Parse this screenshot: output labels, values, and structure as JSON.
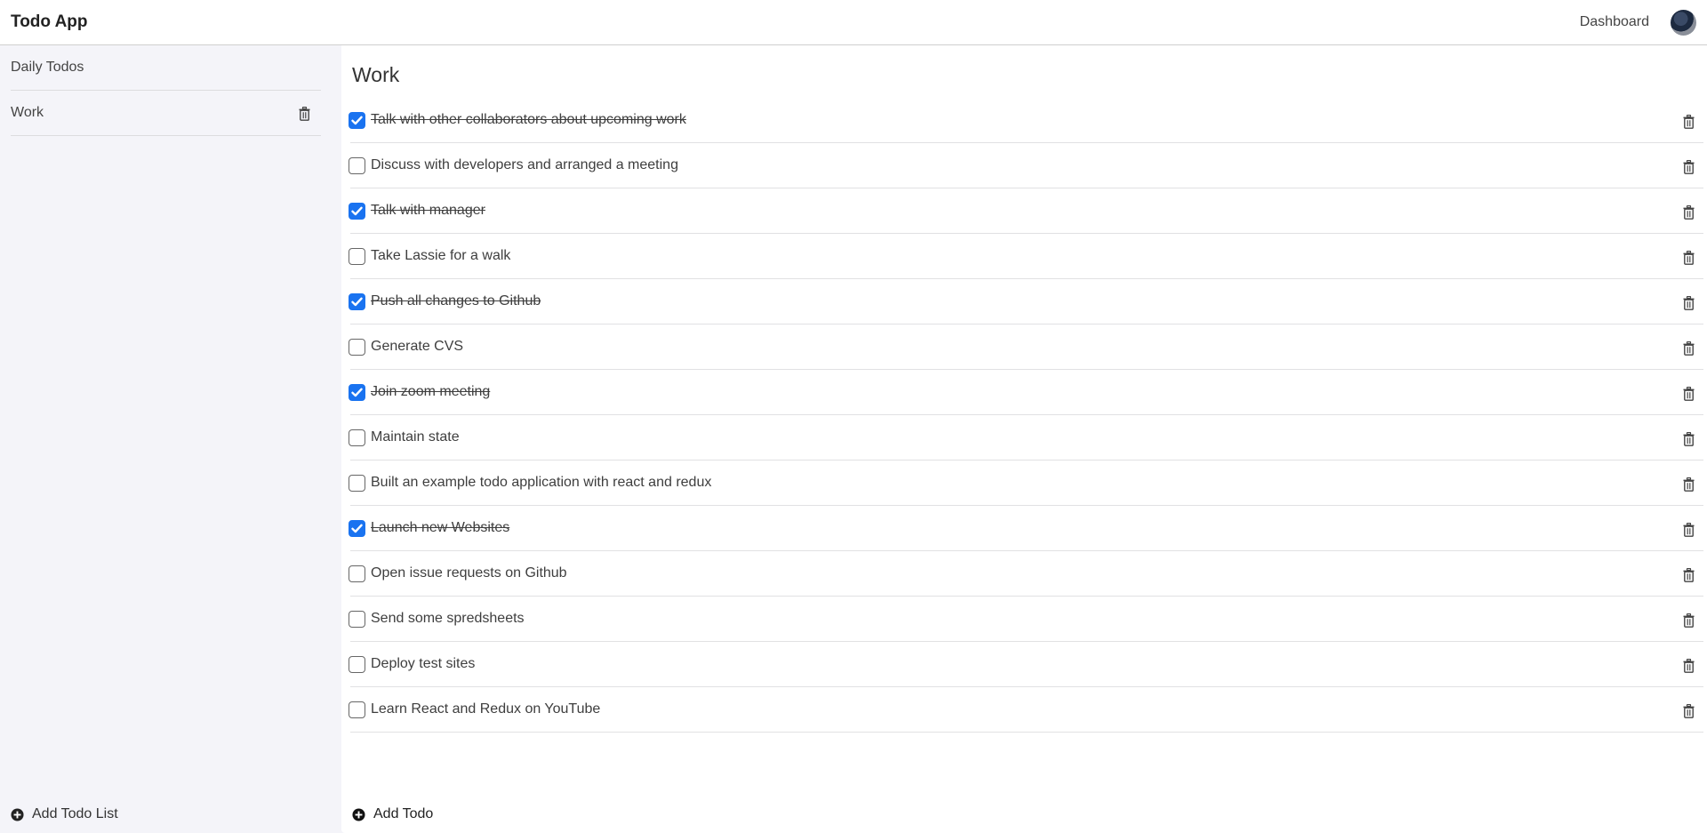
{
  "header": {
    "title": "Todo App",
    "dashboard_label": "Dashboard",
    "avatar_icon": "user-avatar"
  },
  "sidebar": {
    "items": [
      {
        "label": "Daily Todos",
        "has_delete": false
      },
      {
        "label": "Work",
        "has_delete": true
      }
    ],
    "add_list_label": "Add Todo List"
  },
  "main": {
    "title": "Work",
    "todos": [
      {
        "text": "Talk with other collaborators about upcoming work",
        "done": true
      },
      {
        "text": "Discuss with developers and arranged a meeting",
        "done": false
      },
      {
        "text": "Talk with manager",
        "done": true
      },
      {
        "text": "Take Lassie for a walk",
        "done": false
      },
      {
        "text": "Push all changes to Github",
        "done": true
      },
      {
        "text": "Generate CVS",
        "done": false
      },
      {
        "text": "Join zoom meeting",
        "done": true
      },
      {
        "text": "Maintain state",
        "done": false
      },
      {
        "text": "Built an example todo application with react and redux",
        "done": false
      },
      {
        "text": "Launch new Websites",
        "done": true
      },
      {
        "text": "Open issue requests on Github",
        "done": false
      },
      {
        "text": "Send some spredsheets",
        "done": false
      },
      {
        "text": "Deploy test sites",
        "done": false
      },
      {
        "text": "Learn React and Redux on YouTube",
        "done": false
      }
    ],
    "add_todo_label": "Add Todo"
  },
  "colors": {
    "accent": "#1a73f0",
    "sidebar_bg": "#f4f4f9",
    "divider": "#e1e1e3"
  }
}
